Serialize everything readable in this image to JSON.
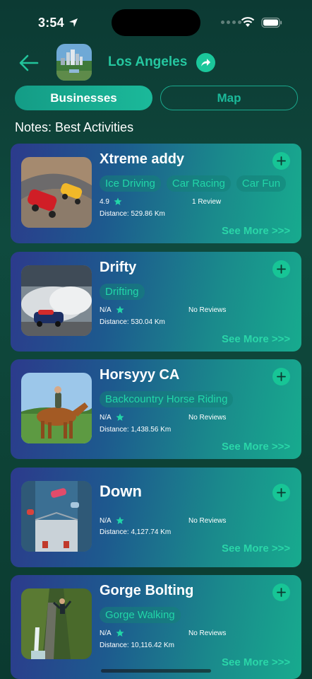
{
  "status": {
    "time": "3:54"
  },
  "header": {
    "city": "Los Angeles"
  },
  "tabs": [
    {
      "label": "Businesses",
      "active": true
    },
    {
      "label": "Map",
      "active": false
    }
  ],
  "notes": "Notes: Best Activities",
  "see_more_label": "See More >>>",
  "cards": [
    {
      "title": "Xtreme addy",
      "tags": [
        "Ice Driving",
        "Car Racing",
        "Car Fun"
      ],
      "rating": "4.9",
      "reviews": "1 Review",
      "distance": "Distance: 529.86 Km"
    },
    {
      "title": "Drifty",
      "tags": [
        "Drifting"
      ],
      "rating": "N/A",
      "reviews": "No Reviews",
      "distance": "Distance: 530.04 Km"
    },
    {
      "title": "Horsyyy CA",
      "tags": [
        "Backcountry Horse Riding"
      ],
      "rating": "N/A",
      "reviews": "No Reviews",
      "distance": "Distance: 1,438.56 Km"
    },
    {
      "title": "Down",
      "tags": [],
      "rating": "N/A",
      "reviews": "No Reviews",
      "distance": "Distance: 4,127.74 Km"
    },
    {
      "title": "Gorge Bolting",
      "tags": [
        "Gorge Walking"
      ],
      "rating": "N/A",
      "reviews": "No Reviews",
      "distance": "Distance: 10,116.42 Km"
    }
  ],
  "colors": {
    "accent": "#1bc79b",
    "tag_text": "#22d6a8",
    "background": "#0f4a3e"
  }
}
